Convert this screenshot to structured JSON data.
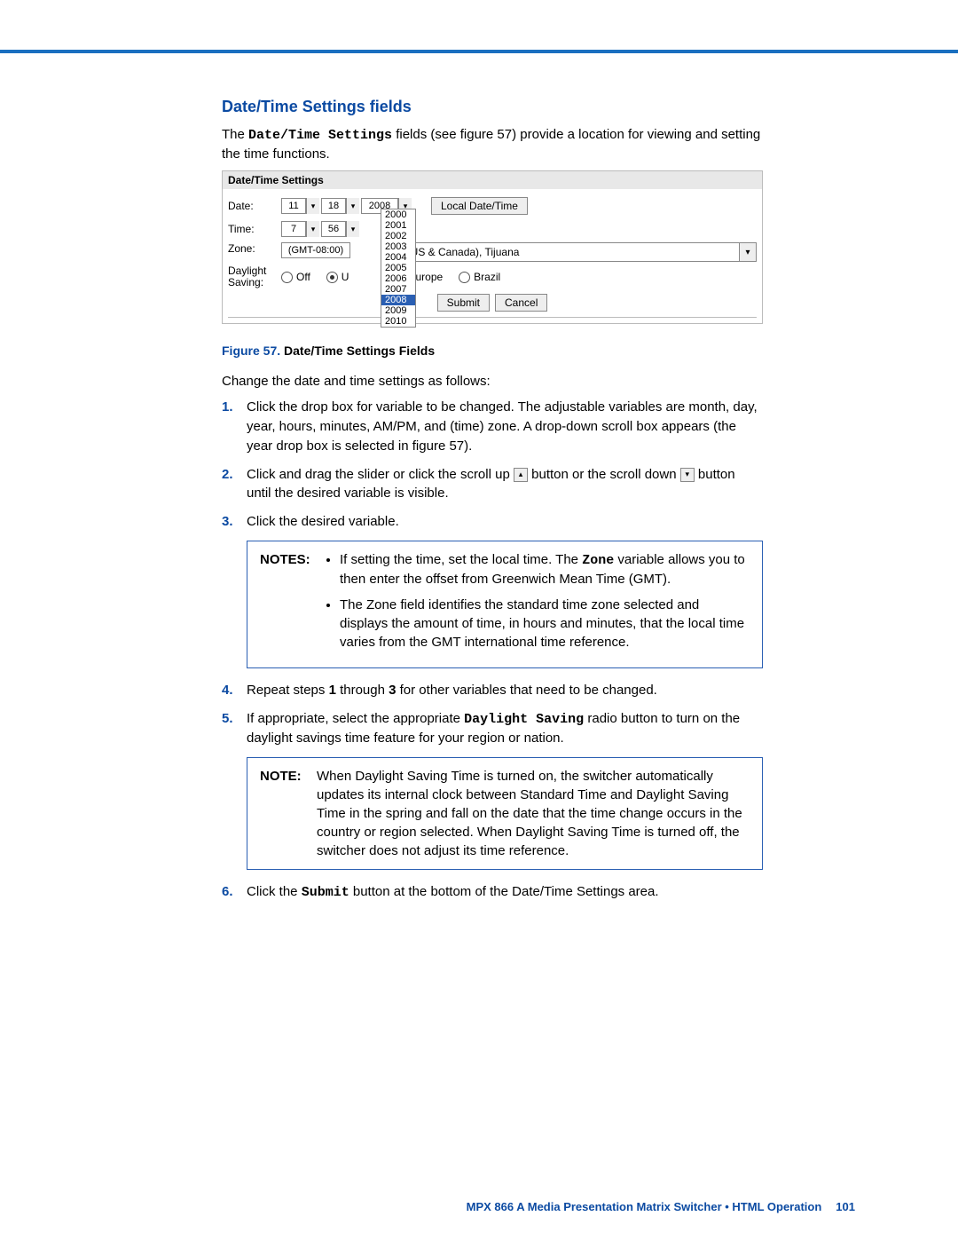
{
  "section_title": "Date/Time Settings fields",
  "intro_pre": "The ",
  "intro_code": "Date/Time Settings",
  "intro_post": " fields (see figure 57) provide a location for viewing and setting the time functions.",
  "panel": {
    "title": "Date/Time Settings",
    "labels": {
      "date": "Date:",
      "time": "Time:",
      "zone": "Zone:",
      "daylight": "Daylight\nSaving:"
    },
    "date": {
      "month": "11",
      "day": "18",
      "year": "2008"
    },
    "time": {
      "hour": "7",
      "min": "56"
    },
    "zone_prefix": "(GMT-08:00)",
    "zone_text": "he (US & Canada), Tijuana",
    "daylight": {
      "off": "Off",
      "usa": "U",
      "europe": "Europe",
      "brazil": "Brazil",
      "selected": "usa"
    },
    "local_btn": "Local Date/Time",
    "submit": "Submit",
    "cancel": "Cancel",
    "yearlist": [
      "2000",
      "2001",
      "2002",
      "2003",
      "2004",
      "2005",
      "2006",
      "2007",
      "2008",
      "2009",
      "2010"
    ],
    "yearlist_sel": "2008"
  },
  "figcap_num": "Figure 57.",
  "figcap_title": " Date/Time Settings Fields",
  "lead2": "Change the date and time settings as follows:",
  "steps": [
    {
      "n": "1.",
      "t": "Click the drop box for variable to be changed. The adjustable variables are month, day, year, hours, minutes, AM/PM, and (time) zone. A drop-down scroll box appears (the year drop box is selected in figure 57)."
    },
    {
      "n": "2.",
      "t_pre": "Click and drag the slider or click the scroll up ",
      "t_mid": " button or the scroll down ",
      "t_post": " button until the desired variable is visible."
    },
    {
      "n": "3.",
      "t": "Click the desired variable."
    }
  ],
  "notes1_label": "NOTES:",
  "notes1": [
    {
      "pre": "If setting the time, set the local time. The ",
      "code": "Zone",
      "post": " variable allows you to then enter the offset from Greenwich Mean Time (GMT)."
    },
    {
      "t": "The Zone field identifies the standard time zone selected and displays the amount of time, in hours and minutes, that the local time varies from the GMT international time reference."
    }
  ],
  "steps2": [
    {
      "n": "4.",
      "pre": "Repeat steps ",
      "b1": "1",
      "mid": " through ",
      "b2": "3",
      "post": " for other variables that need to be changed."
    },
    {
      "n": "5.",
      "pre": "If appropriate, select the appropriate ",
      "code": "Daylight Saving",
      "post": " radio button to turn on the daylight savings time feature for your region or nation."
    }
  ],
  "note2_label": "NOTE:",
  "note2": "When Daylight Saving Time is turned on, the switcher automatically updates its internal clock between Standard Time and Daylight Saving Time in the spring and fall on the date that the time change occurs in the country or region selected. When Daylight Saving Time is turned off, the switcher does not adjust its time reference.",
  "step6": {
    "n": "6.",
    "pre": "Click the ",
    "code": "Submit",
    "post": " button at the bottom of the Date/Time Settings area."
  },
  "footer_text": "MPX 866 A Media Presentation Matrix Switcher • HTML Operation",
  "footer_page": "101"
}
